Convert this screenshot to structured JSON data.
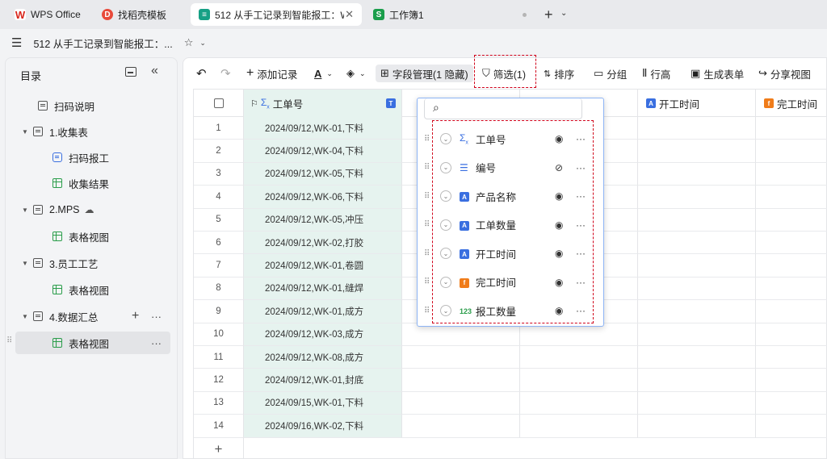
{
  "tabs": [
    {
      "label": "WPS Office",
      "icon": "wps-logo-icon",
      "color": "#d9261c"
    },
    {
      "label": "找稻壳模板",
      "icon": "docer-logo-icon",
      "color": "#e84a3b"
    },
    {
      "label": "512 从手工记录到智能报工：WP",
      "icon": "multidim-table-icon",
      "color": "#16a085",
      "close": "✕"
    },
    {
      "label": "工作簿1",
      "icon": "sheet-s-icon",
      "color": "#1a9e4b",
      "letter": "S"
    }
  ],
  "titlebar": {
    "title": "512 从手工记录到智能报工：...",
    "menu_icon": "hamburger-icon",
    "star_icon": "star-icon"
  },
  "sidebar": {
    "header": "目录",
    "items": [
      {
        "label": "扫码说明",
        "type": "doc"
      },
      {
        "label": "1.收集表",
        "type": "group"
      },
      {
        "label": "扫码报工",
        "type": "form"
      },
      {
        "label": "收集结果",
        "type": "grid"
      },
      {
        "label": "2.MPS",
        "type": "group"
      },
      {
        "label": "表格视图",
        "type": "grid"
      },
      {
        "label": "3.员工工艺",
        "type": "group"
      },
      {
        "label": "表格视图",
        "type": "grid"
      },
      {
        "label": "4.数据汇总",
        "type": "group"
      },
      {
        "label": "表格视图",
        "type": "grid"
      }
    ]
  },
  "toolbar": {
    "add_record": "添加记录",
    "field_manage": "字段管理(1 隐藏)",
    "filter": "筛选(1)",
    "sort": "排序",
    "group": "分组",
    "row_height": "行高",
    "gen_form": "生成表单",
    "share_view": "分享视图"
  },
  "columns": [
    {
      "label": "工单号",
      "tag": "T"
    },
    {
      "label": "开工时间",
      "tag": "A"
    },
    {
      "label": "完工时间",
      "tag": "f"
    }
  ],
  "rows": [
    {
      "n": "1",
      "v": "2024/09/12,WK-01,下料"
    },
    {
      "n": "2",
      "v": "2024/09/12,WK-04,下料"
    },
    {
      "n": "3",
      "v": "2024/09/12,WK-05,下料"
    },
    {
      "n": "4",
      "v": "2024/09/12,WK-06,下料"
    },
    {
      "n": "5",
      "v": "2024/09/12,WK-05,冲压"
    },
    {
      "n": "6",
      "v": "2024/09/12,WK-02,打胶"
    },
    {
      "n": "7",
      "v": "2024/09/12,WK-01,卷圆"
    },
    {
      "n": "8",
      "v": "2024/09/12,WK-01,缝焊"
    },
    {
      "n": "9",
      "v": "2024/09/12,WK-01,成方"
    },
    {
      "n": "10",
      "v": "2024/09/12,WK-03,成方"
    },
    {
      "n": "11",
      "v": "2024/09/12,WK-08,成方"
    },
    {
      "n": "12",
      "v": "2024/09/12,WK-01,封底"
    },
    {
      "n": "13",
      "v": "2024/09/15,WK-01,下料"
    },
    {
      "n": "14",
      "v": "2024/09/16,WK-02,下料"
    }
  ],
  "add_row": "+",
  "field_popup": {
    "fields": [
      {
        "label": "工单号",
        "icon": "formula-icon",
        "visible": "eye-icon"
      },
      {
        "label": "编号",
        "icon": "list-number-icon",
        "visible": "eye-off-icon"
      },
      {
        "label": "产品名称",
        "icon": "text-a-icon",
        "visible": "eye-icon"
      },
      {
        "label": "工单数量",
        "icon": "text-a-icon",
        "visible": "eye-icon"
      },
      {
        "label": "开工时间",
        "icon": "text-a-icon",
        "visible": "eye-icon"
      },
      {
        "label": "完工时间",
        "icon": "function-f-icon",
        "visible": "eye-icon"
      },
      {
        "label": "报工数量",
        "icon": "number-123-icon",
        "visible": "eye-icon"
      }
    ]
  },
  "colors": {
    "accent": "#3a6fe0",
    "highlight": "#d0021b",
    "first_col_bg": "#e6f3ef"
  }
}
